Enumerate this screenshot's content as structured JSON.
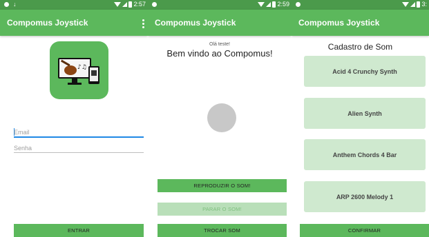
{
  "screens": [
    {
      "status_time": "2:57",
      "app_title": "Compomus Joystick",
      "email_placeholder": "Email",
      "password_placeholder": "Senha",
      "enter_label": "ENTRAR"
    },
    {
      "status_time": "2:59",
      "app_title": "Compomus Joystick",
      "greeting_small": "Olá teste!",
      "greeting_big": "Bem vindo ao Compomus!",
      "play_label": "REPRODUZIR O SOM!",
      "stop_label": "PARAR O SOM!",
      "change_label": "TROCAR SOM"
    },
    {
      "status_time": "3:",
      "app_title": "Compomus Joystick",
      "list_title": "Cadastro de Som",
      "sounds": [
        "Acid 4 Crunchy Synth",
        "Alien Synth",
        "Anthem Chords 4 Bar",
        "ARP 2600 Melody 1"
      ],
      "confirm_label": "CONFIRMAR"
    }
  ],
  "colors": {
    "status_bar": "#4b9a4b",
    "app_bar": "#5cb85c",
    "button": "#5cb85c",
    "button_disabled": "#b9dfb9",
    "card": "#cfe9cf",
    "focus_line": "#1e88e5"
  }
}
